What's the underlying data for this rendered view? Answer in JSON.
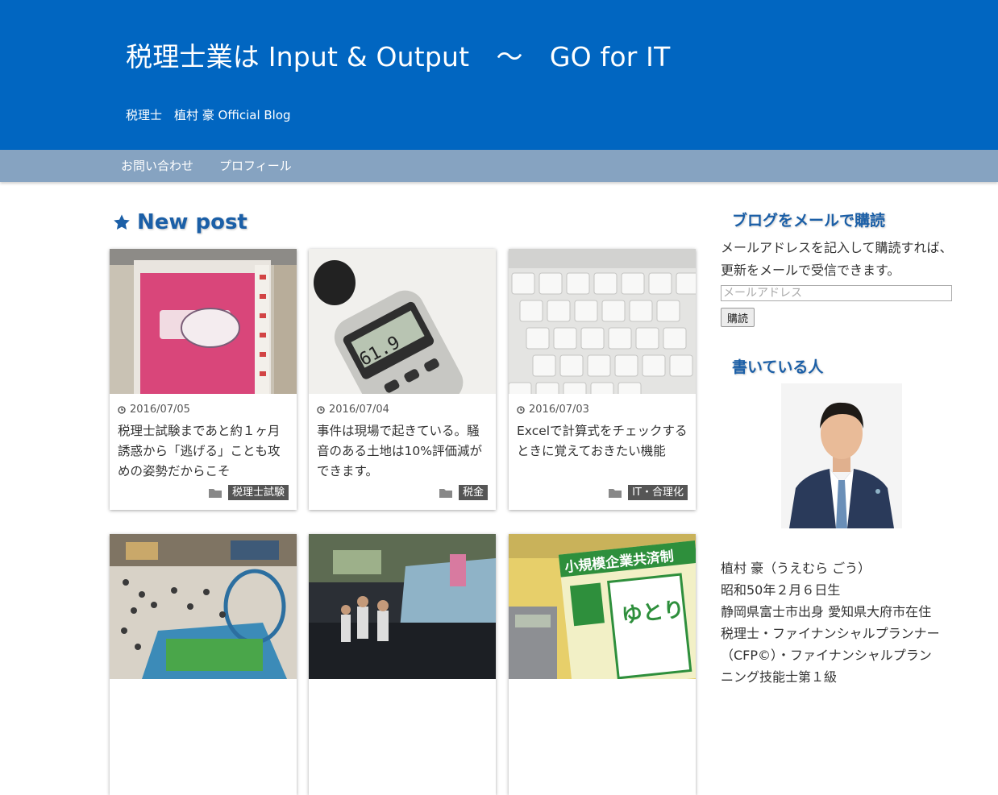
{
  "header": {
    "site_title": "税理士業は Input & Output　～　GO for IT",
    "site_description": "税理士　植村 豪 Official Blog"
  },
  "nav": {
    "items": [
      {
        "label": "お問い合わせ"
      },
      {
        "label": "プロフィール"
      }
    ]
  },
  "main": {
    "section_title": "New post",
    "section_icon": "star-icon",
    "posts": [
      {
        "date": "2016/07/05",
        "title": "税理士試験まであと約１ヶ月　誘惑から「逃げる」ことも攻めの姿勢だからこそ",
        "category": "税理士試験",
        "thumb": "tax-exam-card-photo"
      },
      {
        "date": "2016/07/04",
        "title": "事件は現場で起きている。騒音のある土地は10%評価減ができます。",
        "category": "税金",
        "thumb": "sound-level-meter-photo",
        "meter_reading": "61.9"
      },
      {
        "date": "2016/07/03",
        "title": "Excelで計算式をチェックするときに覚えておきたい機能",
        "category": "IT・合理化",
        "thumb": "keyboard-photo"
      },
      {
        "date": "",
        "title": "",
        "category": "",
        "thumb": "shopping-mall-photo"
      },
      {
        "date": "",
        "title": "",
        "category": "",
        "thumb": "event-stage-photo"
      },
      {
        "date": "",
        "title": "",
        "category": "",
        "thumb": "mutual-aid-pamphlet-photo",
        "pamphlet_heading": "小規模企業共済制",
        "pamphlet_word": "ゆとり"
      }
    ]
  },
  "sidebar": {
    "subscribe": {
      "title": "ブログをメールで購読",
      "description": "メールアドレスを記入して購読すれば、更新をメールで受信できます。",
      "email_placeholder": "メールアドレス",
      "button_label": "購読"
    },
    "author": {
      "title": "書いている人",
      "lines": [
        "植村 豪（うえむら ごう）",
        "昭和50年２月６日生",
        "静岡県富士市出身 愛知県大府市在住",
        "税理士・ファイナンシャルプランナー",
        "（CFP©）・ファイナンシャルプラン",
        "ニング技能士第１級"
      ]
    }
  },
  "colors": {
    "header_bg": "#0166c1",
    "nav_bg": "#86a3c1",
    "accent": "#1b5fa7",
    "badge_bg": "#555555"
  }
}
